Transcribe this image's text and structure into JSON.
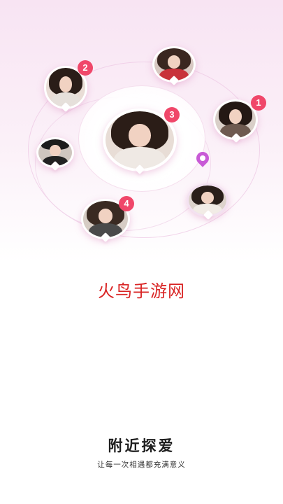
{
  "watermark": "火鸟手游网",
  "headline": "附近探爱",
  "tagline": "让每一次相遇都充满意义",
  "badges": {
    "user_2": "2",
    "user_1": "1",
    "user_3": "3",
    "user_4": "4"
  },
  "colors": {
    "badge": "#f0476a",
    "location_pin": "#c85ad6",
    "background_top": "#f8e4f3",
    "watermark": "#d92424"
  },
  "icons": {
    "map_marker": "location-pin-icon"
  }
}
